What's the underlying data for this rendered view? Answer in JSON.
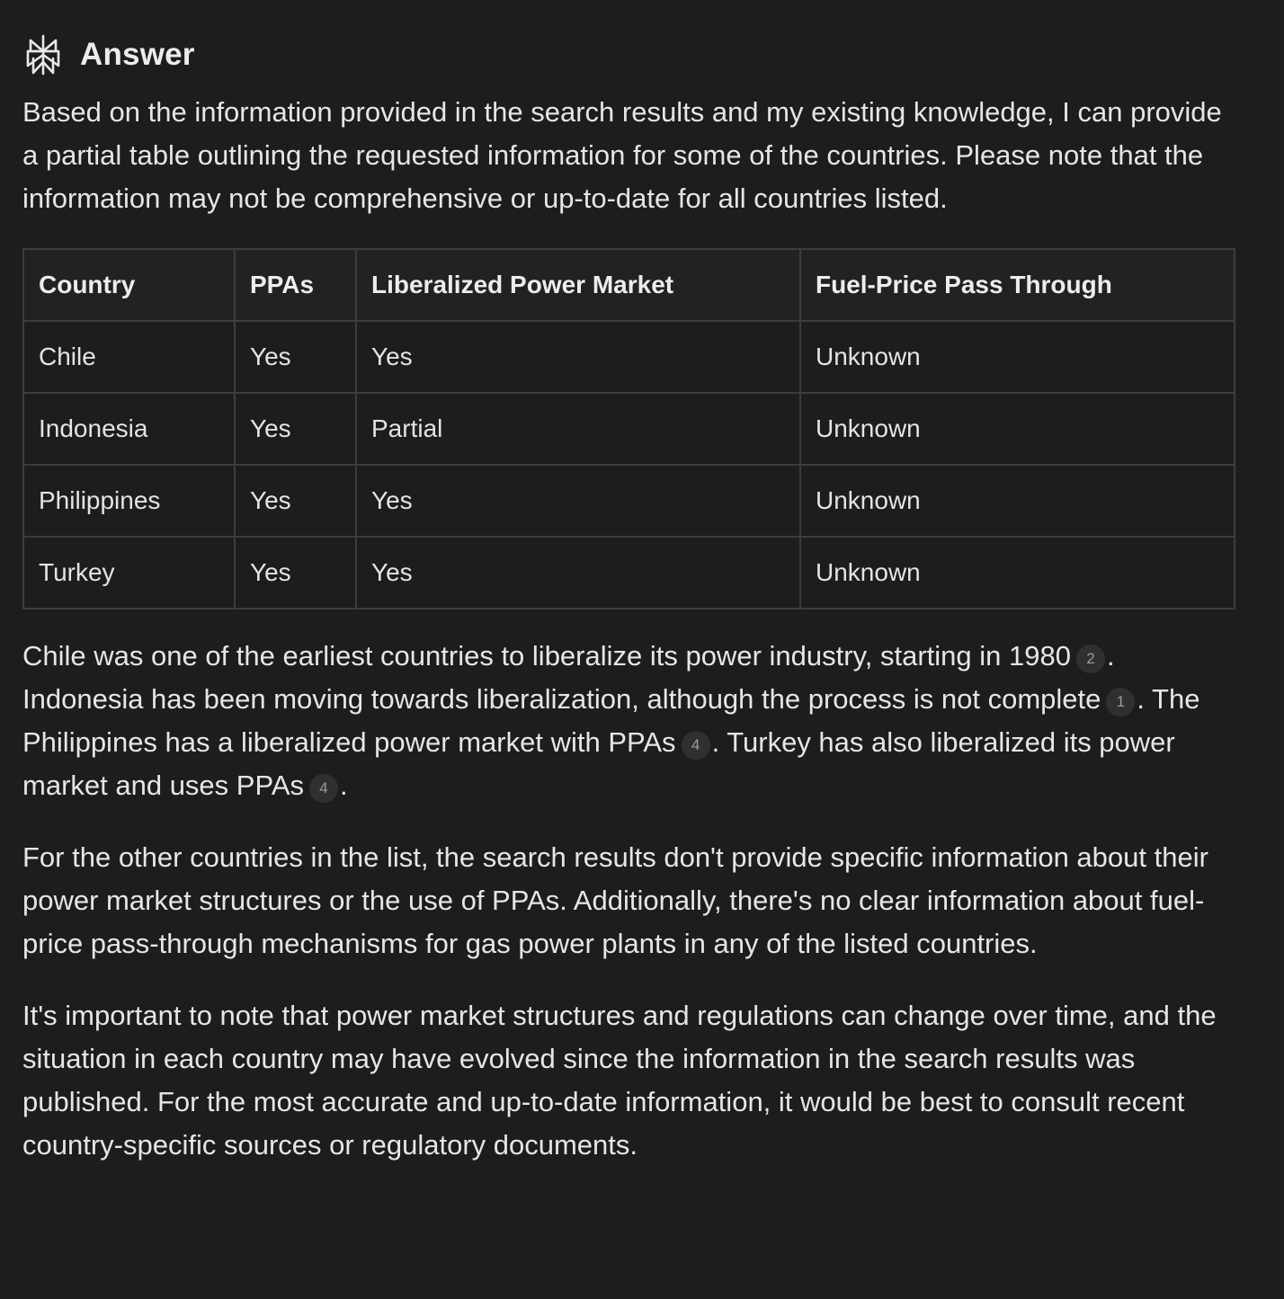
{
  "header": {
    "icon": "perplexity-logo-icon",
    "title": "Answer"
  },
  "intro": "Based on the information provided in the search results and my existing knowledge, I can provide a partial table outlining the requested information for some of the countries. Please note that the information may not be comprehensive or up-to-date for all countries listed.",
  "table": {
    "headers": [
      "Country",
      "PPAs",
      "Liberalized Power Market",
      "Fuel-Price Pass Through"
    ],
    "rows": [
      [
        "Chile",
        "Yes",
        "Yes",
        "Unknown"
      ],
      [
        "Indonesia",
        "Yes",
        "Partial",
        "Unknown"
      ],
      [
        "Philippines",
        "Yes",
        "Yes",
        "Unknown"
      ],
      [
        "Turkey",
        "Yes",
        "Yes",
        "Unknown"
      ]
    ]
  },
  "para2": {
    "s1": "Chile was one of the earliest countries to liberalize its power industry, starting in 1980",
    "c1": "2",
    "s2": ". Indonesia has been moving towards liberalization, although the process is not complete",
    "c2": "1",
    "s3": ". The Philippines has a liberalized power market with PPAs",
    "c3": "4",
    "s4": ". Turkey has also liberalized its power market and uses PPAs",
    "c4": "4",
    "s5": "."
  },
  "para3": "For the other countries in the list, the search results don't provide specific information about their power market structures or the use of PPAs. Additionally, there's no clear information about fuel-price pass-through mechanisms for gas power plants in any of the listed countries.",
  "para4": "It's important to note that power market structures and regulations can change over time, and the situation in each country may have evolved since the information in the search results was published. For the most accurate and up-to-date information, it would be best to consult recent country-specific sources or regulatory documents.",
  "colors": {
    "background": "#1c1d1d",
    "text": "#e6e6e4",
    "table_border": "#3b3d3e",
    "table_header_bg": "#212222",
    "citation_bg": "#2f3131",
    "citation_text": "#9c9d9b"
  }
}
